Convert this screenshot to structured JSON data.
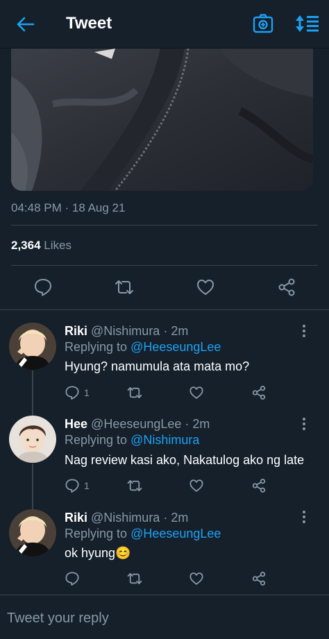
{
  "header": {
    "title": "Tweet",
    "back_icon": "arrow-left-icon",
    "camera_icon": "camera-icon",
    "sort_icon": "sort-icon",
    "accent": "#1da1f2"
  },
  "tweet": {
    "timestamp": "04:48 PM · 18 Aug 21",
    "likes_count": "2,364",
    "likes_label": "Likes"
  },
  "replies": [
    {
      "name": "Riki",
      "handle": "@Nishimura · 2m",
      "replying_label": "Replying to",
      "replying_to": "@HeeseungLee",
      "text": "Hyung? namumula ata mata mo?",
      "reply_count": "1"
    },
    {
      "name": "Hee",
      "handle": "@HeeseungLee · 2m",
      "replying_label": "Replying to",
      "replying_to": "@Nishimura",
      "text": "Nag review kasi ako, Nakatulog ako ng late",
      "reply_count": "1"
    },
    {
      "name": "Riki",
      "handle": "@Nishimura · 2m",
      "replying_label": "Replying to",
      "replying_to": "@HeeseungLee",
      "text": "ok hyung😊",
      "reply_count": ""
    }
  ],
  "compose": {
    "placeholder": "Tweet your reply"
  },
  "colors": {
    "background": "#15202b",
    "secondary_text": "#8899a6",
    "divider": "#38444d"
  }
}
